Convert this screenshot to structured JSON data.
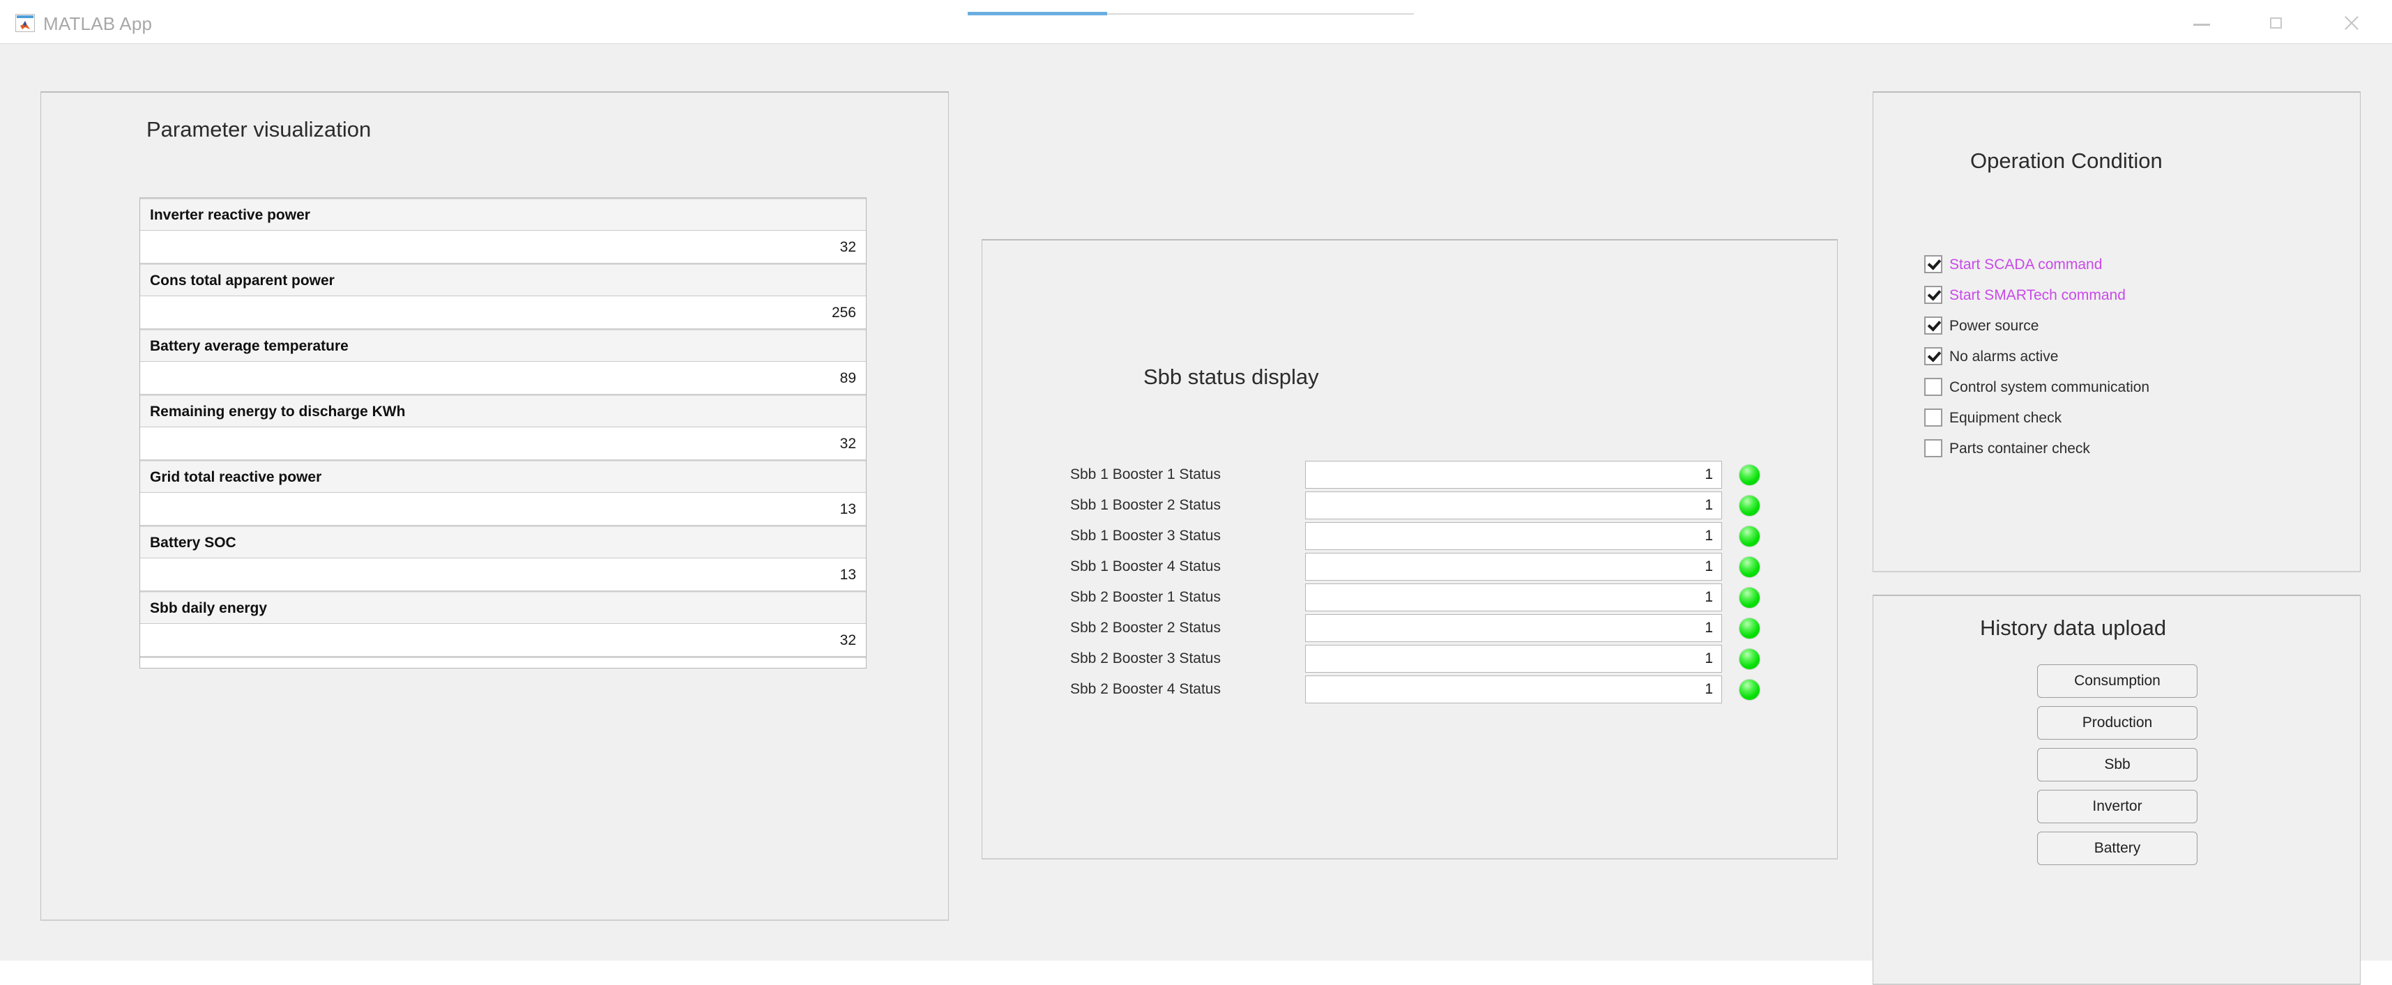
{
  "window": {
    "title": "MATLAB App",
    "icon": "matlab-app-icon",
    "controls": {
      "minimize": "minimize-icon",
      "maximize": "maximize-icon",
      "close": "close-icon"
    }
  },
  "parameter_panel": {
    "title": "Parameter visualization",
    "rows": [
      {
        "label": "Inverter reactive power",
        "value": "32"
      },
      {
        "label": "Cons total apparent power",
        "value": "256"
      },
      {
        "label": "Battery average temperature",
        "value": "89"
      },
      {
        "label": "Remaining energy to discharge KWh",
        "value": "32"
      },
      {
        "label": "Grid total reactive power",
        "value": "13"
      },
      {
        "label": "Battery SOC",
        "value": "13"
      },
      {
        "label": "Sbb daily energy",
        "value": "32"
      }
    ]
  },
  "sbb_panel": {
    "title": "Sbb status display",
    "rows": [
      {
        "label": "Sbb 1 Booster 1 Status",
        "value": "1",
        "lamp": "green-lamp-icon"
      },
      {
        "label": "Sbb 1 Booster 2 Status",
        "value": "1",
        "lamp": "green-lamp-icon"
      },
      {
        "label": "Sbb 1 Booster 3 Status",
        "value": "1",
        "lamp": "green-lamp-icon"
      },
      {
        "label": "Sbb 1 Booster 4 Status",
        "value": "1",
        "lamp": "green-lamp-icon"
      },
      {
        "label": "Sbb 2 Booster 1 Status",
        "value": "1",
        "lamp": "green-lamp-icon"
      },
      {
        "label": "Sbb 2 Booster 2 Status",
        "value": "1",
        "lamp": "green-lamp-icon"
      },
      {
        "label": "Sbb 2 Booster 3 Status",
        "value": "1",
        "lamp": "green-lamp-icon"
      },
      {
        "label": "Sbb 2 Booster 4 Status",
        "value": "1",
        "lamp": "green-lamp-icon"
      }
    ]
  },
  "operation_panel": {
    "title": "Operation Condition",
    "checkboxes": [
      {
        "label": "Start SCADA command",
        "checked": true,
        "color": "#c84ae8"
      },
      {
        "label": "Start SMARTech command",
        "checked": true,
        "color": "#c84ae8"
      },
      {
        "label": "Power source",
        "checked": true,
        "color": "#2d2d2d"
      },
      {
        "label": "No alarms active",
        "checked": true,
        "color": "#2d2d2d"
      },
      {
        "label": "Control system communication",
        "checked": false,
        "color": "#2d2d2d"
      },
      {
        "label": "Equipment check",
        "checked": false,
        "color": "#2d2d2d"
      },
      {
        "label": "Parts container check",
        "checked": false,
        "color": "#2d2d2d"
      }
    ]
  },
  "history_panel": {
    "title": "History data upload",
    "buttons": [
      {
        "label": "Consumption"
      },
      {
        "label": "Production"
      },
      {
        "label": "Sbb"
      },
      {
        "label": "Invertor"
      },
      {
        "label": "Battery"
      }
    ]
  },
  "colors": {
    "app_background": "#f0f0f0",
    "panel_border": "#c2c2c2",
    "lamp_green": "#07e007",
    "magenta_text": "#c84ae8",
    "accent_blue": "#6aaee0"
  }
}
